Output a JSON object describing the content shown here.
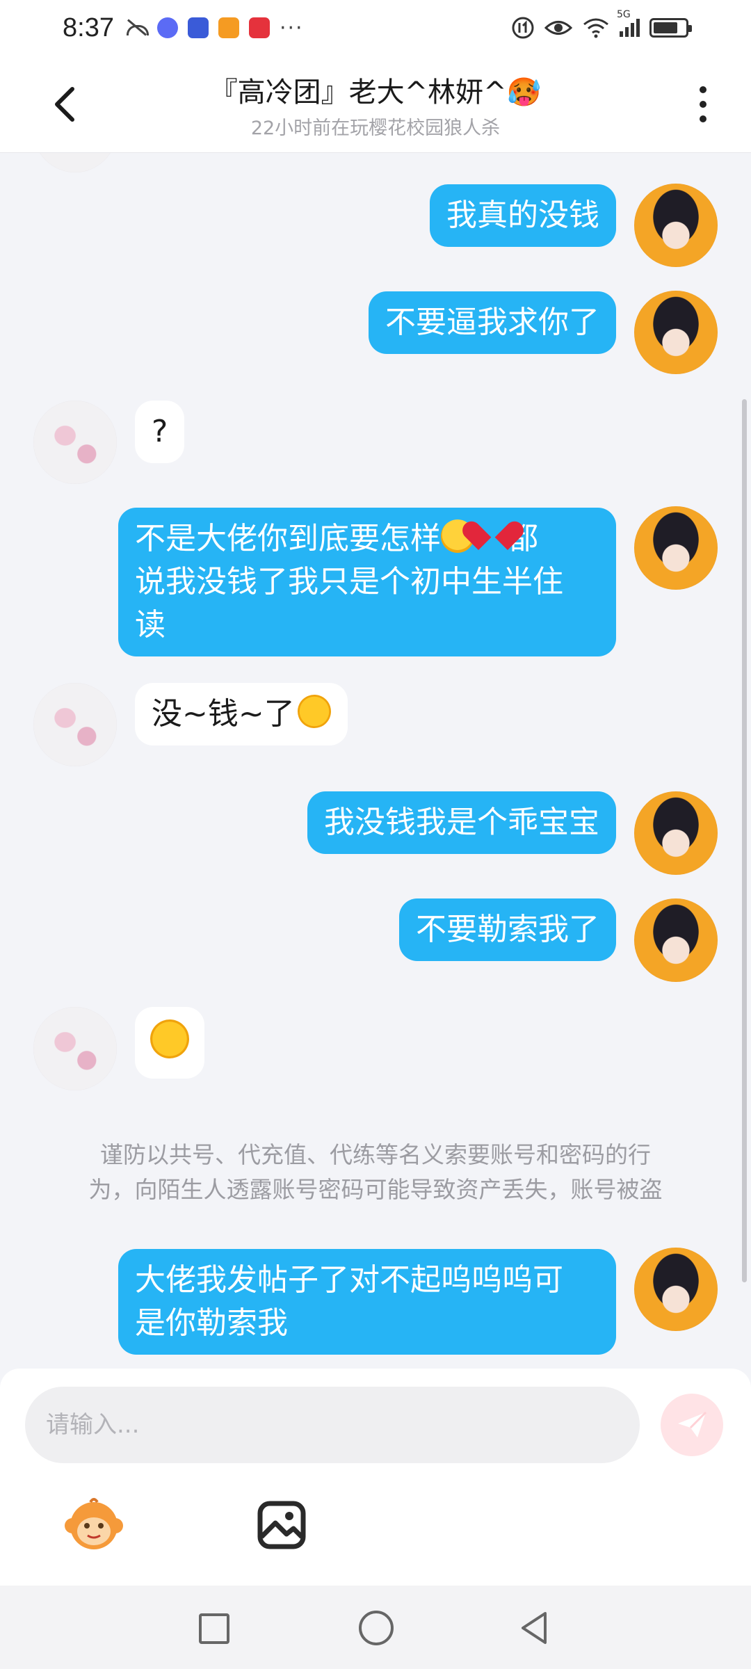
{
  "status_bar": {
    "time": "8:37",
    "network": "5G",
    "more_indicator": "···",
    "app_icon_colors": [
      "#5b6bf5",
      "#3a5bd8",
      "#f59b22",
      "#e5323c"
    ]
  },
  "header": {
    "title": "『高冷团』老大^林妍^🥵",
    "subtitle": "22小时前在玩樱花校园狼人杀"
  },
  "messages": [
    {
      "side": "me",
      "text": "我真的没钱"
    },
    {
      "side": "me",
      "text": "不要逼我求你了"
    },
    {
      "side": "peer",
      "text": "?"
    },
    {
      "side": "me",
      "text_parts": [
        "不是大佬你到底要怎样",
        "都",
        "说我没钱了我只是个初中生半住",
        "读"
      ],
      "emojis": [
        "loudly-crying-emoji",
        "broken-heart-emoji"
      ]
    },
    {
      "side": "peer",
      "text": "没~钱~了",
      "emojis": [
        "rolling-laughing-emoji"
      ]
    },
    {
      "side": "me",
      "text": "我没钱我是个乖宝宝"
    },
    {
      "side": "me",
      "text": "不要勒索我了"
    },
    {
      "side": "peer",
      "emojis": [
        "rolling-laughing-emoji"
      ]
    },
    {
      "side": "me",
      "text_parts": [
        "大佬我发帖子了对不起呜呜呜可",
        "是你勒索我"
      ]
    }
  ],
  "notice": {
    "line1": "谨防以共号、代充值、代练等名义索要账号和密码的行",
    "line2": "为，向陌生人透露账号密码可能导致资产丢失，账号被盗"
  },
  "input": {
    "placeholder": "请输入...",
    "value": ""
  },
  "toolbar": {
    "icons": [
      "monkey-emoji-icon",
      "image-icon"
    ]
  },
  "colors": {
    "my_bubble": "#26b4f5",
    "peer_bubble": "#ffffff",
    "chat_background": "#f3f4f8",
    "send_button": "#ffe3e6",
    "notice_text": "#9c9ca2"
  }
}
